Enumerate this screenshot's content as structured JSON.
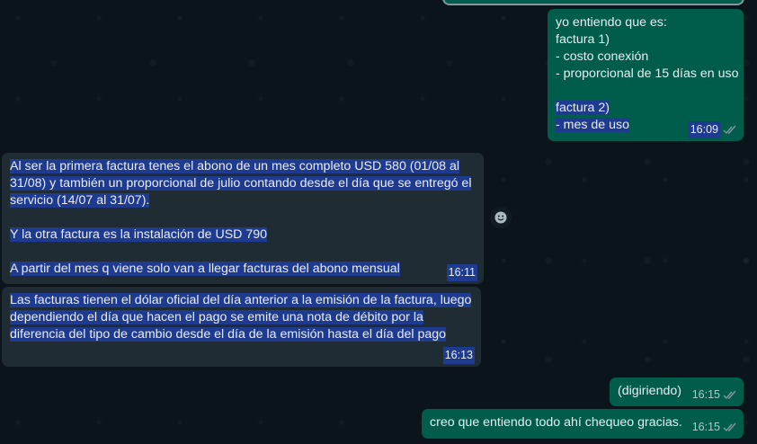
{
  "messages": [
    {
      "direction": "outgoing",
      "lines": [
        "yo entiendo que es:",
        "factura 1)",
        "- costo conexión",
        "- proporcional de 15 días en uso",
        "",
        "factura 2)",
        "- mes de uso"
      ],
      "time": "16:09",
      "status": "read"
    },
    {
      "direction": "incoming",
      "lines": [
        "Al ser la primera factura tenes el abono de un mes completo USD 580 (01/08 al",
        "31/08) y también un proporcional de julio contando desde el día que se entregó el",
        "servicio (14/07 al 31/07).",
        "",
        "Y la otra factura es la instalación de USD 790",
        "",
        "A partir del mes q viene solo van a llegar facturas del abono mensual"
      ],
      "time": "16:11"
    },
    {
      "direction": "incoming",
      "lines": [
        "Las facturas tienen el dólar oficial del día anterior a la emisión de la factura, luego",
        "dependiendo el día que hacen el pago se emite una nota de débito por la",
        "diferencia del tipo de cambio desde el día de la emisión hasta el día del pago"
      ],
      "time": "16:13"
    },
    {
      "direction": "outgoing",
      "lines": [
        "(digiriendo)"
      ],
      "time": "16:15",
      "status": "read"
    },
    {
      "direction": "outgoing",
      "lines": [
        "creo que entiendo todo ahí chequeo gracias."
      ],
      "time": "16:15",
      "status": "read"
    }
  ],
  "react_button_icon": "emoji-smile-icon",
  "colors": {
    "background": "#0b141a",
    "outgoing_bubble": "#005c4b",
    "incoming_bubble": "#202c33",
    "selection": "#1f3b8f"
  }
}
